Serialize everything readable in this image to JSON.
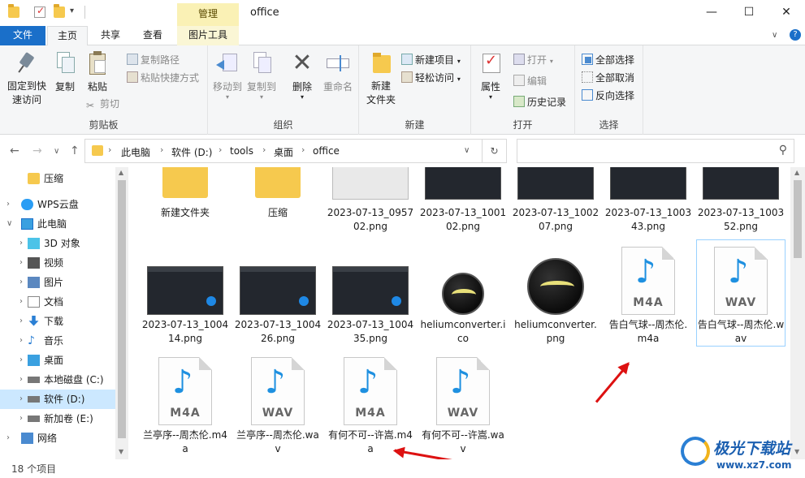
{
  "window": {
    "title": "office",
    "context_tab": "管理",
    "minimize": "—",
    "maximize": "☐",
    "close": "✕"
  },
  "ribbon_tabs": [
    "文件",
    "主页",
    "共享",
    "查看",
    "图片工具"
  ],
  "ribbon": {
    "clipboard": {
      "label": "剪贴板",
      "pin": "固定到快\n速访问",
      "copy": "复制",
      "paste": "粘贴",
      "copy_path": "复制路径",
      "paste_shortcut": "粘贴快捷方式",
      "cut": "剪切"
    },
    "organize": {
      "label": "组织",
      "move_to": "移动到",
      "copy_to": "复制到",
      "delete": "删除",
      "rename": "重命名"
    },
    "new": {
      "label": "新建",
      "new_folder": "新建\n文件夹",
      "new_item": "新建项目",
      "easy_access": "轻松访问"
    },
    "open": {
      "label": "打开",
      "properties": "属性",
      "open": "打开",
      "edit": "编辑",
      "history": "历史记录"
    },
    "select": {
      "label": "选择",
      "select_all": "全部选择",
      "select_none": "全部取消",
      "invert": "反向选择"
    }
  },
  "address": {
    "crumbs": [
      "此电脑",
      "软件 (D:)",
      "tools",
      "桌面",
      "office"
    ],
    "search_placeholder": ""
  },
  "nav_pane": [
    {
      "label": "压缩",
      "icon": "folder-icon",
      "indent": 1,
      "chevron": ""
    },
    {
      "label": "WPS云盘",
      "icon": "cloud-icon",
      "indent": 0,
      "chevron": ">"
    },
    {
      "label": "此电脑",
      "icon": "computer-icon",
      "indent": 0,
      "chevron": "v"
    },
    {
      "label": "3D 对象",
      "icon": "cube-icon",
      "indent": 1,
      "chevron": ">"
    },
    {
      "label": "视频",
      "icon": "video-icon",
      "indent": 1,
      "chevron": ">"
    },
    {
      "label": "图片",
      "icon": "picture-icon",
      "indent": 1,
      "chevron": ">"
    },
    {
      "label": "文档",
      "icon": "document-icon",
      "indent": 1,
      "chevron": ">"
    },
    {
      "label": "下载",
      "icon": "download-icon",
      "indent": 1,
      "chevron": ">"
    },
    {
      "label": "音乐",
      "icon": "music-icon",
      "indent": 1,
      "chevron": ">"
    },
    {
      "label": "桌面",
      "icon": "desktop-icon",
      "indent": 1,
      "chevron": ">"
    },
    {
      "label": "本地磁盘 (C:)",
      "icon": "drive-icon",
      "indent": 1,
      "chevron": ">"
    },
    {
      "label": "软件 (D:)",
      "icon": "drive-icon",
      "indent": 1,
      "chevron": ">",
      "selected": true
    },
    {
      "label": "新加卷 (E:)",
      "icon": "drive-icon",
      "indent": 1,
      "chevron": ">"
    },
    {
      "label": "网络",
      "icon": "network-icon",
      "indent": 0,
      "chevron": ">"
    }
  ],
  "files_row1": [
    "新建文件夹",
    "压缩",
    "2023-07-13_095702.png",
    "2023-07-13_100102.png",
    "2023-07-13_100207.png",
    "2023-07-13_100343.png",
    "2023-07-13_100352.png"
  ],
  "files_row2": [
    "2023-07-13_100414.png",
    "2023-07-13_100426.png",
    "2023-07-13_100435.png",
    "heliumconverter.ico",
    "heliumconverter.png",
    "告白气球--周杰伦.m4a",
    "告白气球--周杰伦.wav"
  ],
  "files_row3": [
    "兰亭序--周杰伦.m4a",
    "兰亭序--周杰伦.wav",
    "有何不可--许嵩.m4a",
    "有何不可--许嵩.wav"
  ],
  "audio_formats": {
    "m4a": "M4A",
    "wav": "WAV"
  },
  "status": {
    "count": "18 个项目"
  },
  "watermark": {
    "brand": "极光下载站",
    "url": "www.xz7.com"
  },
  "colors": {
    "accent": "#1a6fc9",
    "selection": "#cce8ff",
    "annotation_arrow": "#dd1111"
  }
}
